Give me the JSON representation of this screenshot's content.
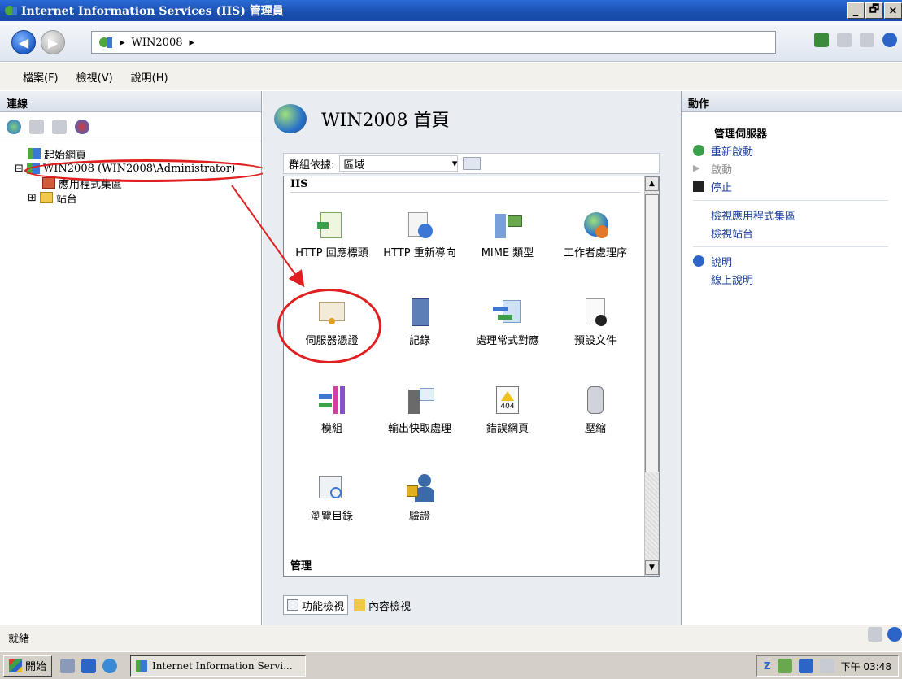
{
  "window": {
    "title": "Internet Information Services (IIS) 管理員",
    "min": "_",
    "max": "🗗",
    "close": "×"
  },
  "address": {
    "segments": [
      "WIN2008"
    ],
    "sep": "▸"
  },
  "menu": [
    "檔案(F)",
    "檢視(V)",
    "說明(H)"
  ],
  "connections": {
    "header": "連線",
    "tree": [
      {
        "label": "起始網頁",
        "depth": 0
      },
      {
        "label": "WIN2008 (WIN2008\\Administrator)",
        "depth": 0,
        "expander": "⊟"
      },
      {
        "label": "應用程式集區",
        "depth": 1
      },
      {
        "label": "站台",
        "depth": 1,
        "expander": "⊞"
      }
    ]
  },
  "center": {
    "title": "WIN2008 首頁",
    "group_label": "群組依據:",
    "group_value": "區域",
    "section_iis": "IIS",
    "section_mgmt": "管理",
    "features": [
      {
        "label": "HTTP 回應標頭",
        "icon": "http-response-headers-icon"
      },
      {
        "label": "HTTP 重新導向",
        "icon": "http-redirect-icon"
      },
      {
        "label": "MIME 類型",
        "icon": "mime-types-icon"
      },
      {
        "label": "工作者處理序",
        "icon": "worker-processes-icon"
      },
      {
        "label": "伺服器憑證",
        "icon": "server-certificates-icon"
      },
      {
        "label": "記錄",
        "icon": "logging-icon"
      },
      {
        "label": "處理常式對應",
        "icon": "handler-mappings-icon"
      },
      {
        "label": "預設文件",
        "icon": "default-document-icon"
      },
      {
        "label": "模組",
        "icon": "modules-icon"
      },
      {
        "label": "輸出快取處理",
        "icon": "output-caching-icon"
      },
      {
        "label": "錯誤網頁",
        "icon": "error-pages-icon",
        "badge": "404"
      },
      {
        "label": "壓縮",
        "icon": "compression-icon"
      },
      {
        "label": "瀏覽目錄",
        "icon": "directory-browsing-icon"
      },
      {
        "label": "驗證",
        "icon": "authentication-icon"
      }
    ],
    "tabs": {
      "features_view": "功能檢視",
      "content_view": "內容檢視"
    }
  },
  "actions": {
    "header": "動作",
    "manage_server": "管理伺服器",
    "restart": "重新啟動",
    "start": "啟動",
    "stop": "停止",
    "view_app_pools": "檢視應用程式集區",
    "view_sites": "檢視站台",
    "help_header": "說明",
    "online_help": "線上說明"
  },
  "status": {
    "text": "就緒"
  },
  "taskbar": {
    "start": "開始",
    "task": "Internet Information Servi...",
    "clock": "下午 03:48"
  },
  "colors": {
    "annotation": "#e02020",
    "link": "#1a3f9a"
  }
}
